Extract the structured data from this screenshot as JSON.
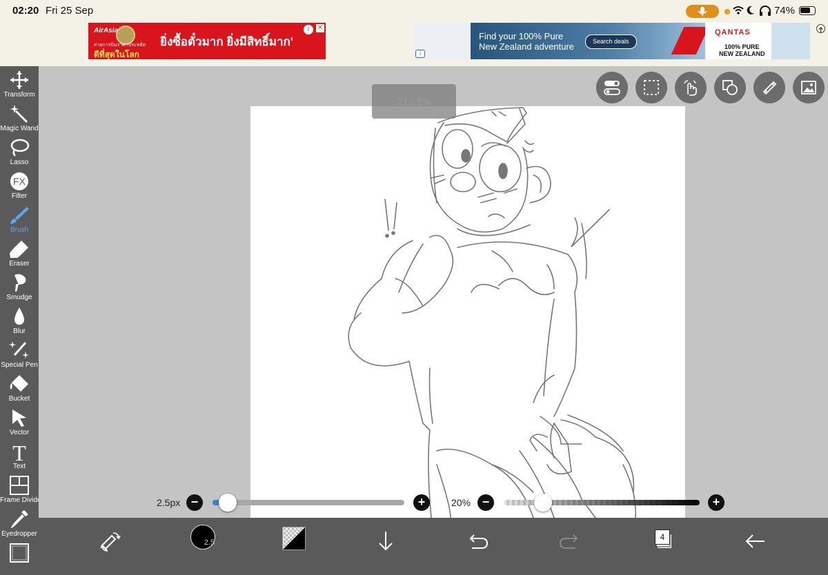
{
  "status_bar": {
    "time": "02:20",
    "date": "Fri 25 Sep",
    "battery_percent": "74%",
    "battery_level": 0.74,
    "icons": [
      "mic-icon",
      "wifi-icon",
      "moon-icon",
      "headphones-icon",
      "battery-icon"
    ]
  },
  "ads": {
    "ad1": {
      "brand": "AirAsia",
      "sub": "สายการบินราคาประหยัด",
      "sub2": "ดีที่สุดในโลก",
      "headline": "ยิ่งซื้อตั๋วมาก ยิ่งมีสิทธิ์มาก'"
    },
    "ad2": {
      "text_line1": "Find your 100% Pure",
      "text_line2": "New Zealand adventure",
      "button": "Search deals",
      "brand": "QANTAS",
      "pure_line1": "100% PURE",
      "pure_line2": "NEW ZEALAND"
    }
  },
  "toolbar": {
    "items": [
      {
        "label": "Transform",
        "icon": "transform-icon"
      },
      {
        "label": "Magic Wand",
        "icon": "magic-wand-icon"
      },
      {
        "label": "Lasso",
        "icon": "lasso-icon"
      },
      {
        "label": "Filter",
        "icon": "fx-icon"
      },
      {
        "label": "Brush",
        "icon": "brush-icon",
        "active": true
      },
      {
        "label": "Eraser",
        "icon": "eraser-icon"
      },
      {
        "label": "Smudge",
        "icon": "smudge-icon"
      },
      {
        "label": "Blur",
        "icon": "blur-icon"
      },
      {
        "label": "Special Pen",
        "icon": "special-pen-icon"
      },
      {
        "label": "Bucket",
        "icon": "bucket-icon"
      },
      {
        "label": "Vector",
        "icon": "vector-icon"
      },
      {
        "label": "Text",
        "icon": "text-icon"
      },
      {
        "label": "Frame Divider",
        "icon": "frame-divider-icon"
      },
      {
        "label": "Eyedropper",
        "icon": "eyedropper-icon"
      },
      {
        "label": "",
        "icon": "canvas-icon"
      }
    ]
  },
  "canvas": {
    "zoom": "212.1%"
  },
  "top_buttons": [
    "toggle-icon",
    "selection-icon",
    "gesture-icon",
    "shapes-icon",
    "ruler-icon",
    "image-icon"
  ],
  "sliders": {
    "brush_size_label": "2.5px",
    "brush_size_fraction": 0.08,
    "opacity_label": "20%",
    "opacity_fraction": 0.2
  },
  "bottom_bar": {
    "brush_size": "2.5",
    "layers_count": "4",
    "icons": [
      "swap-tools-icon",
      "brush-size-icon",
      "color-swatch-icon",
      "download-icon",
      "undo-icon",
      "redo-icon",
      "layers-icon",
      "back-arrow-icon"
    ]
  }
}
